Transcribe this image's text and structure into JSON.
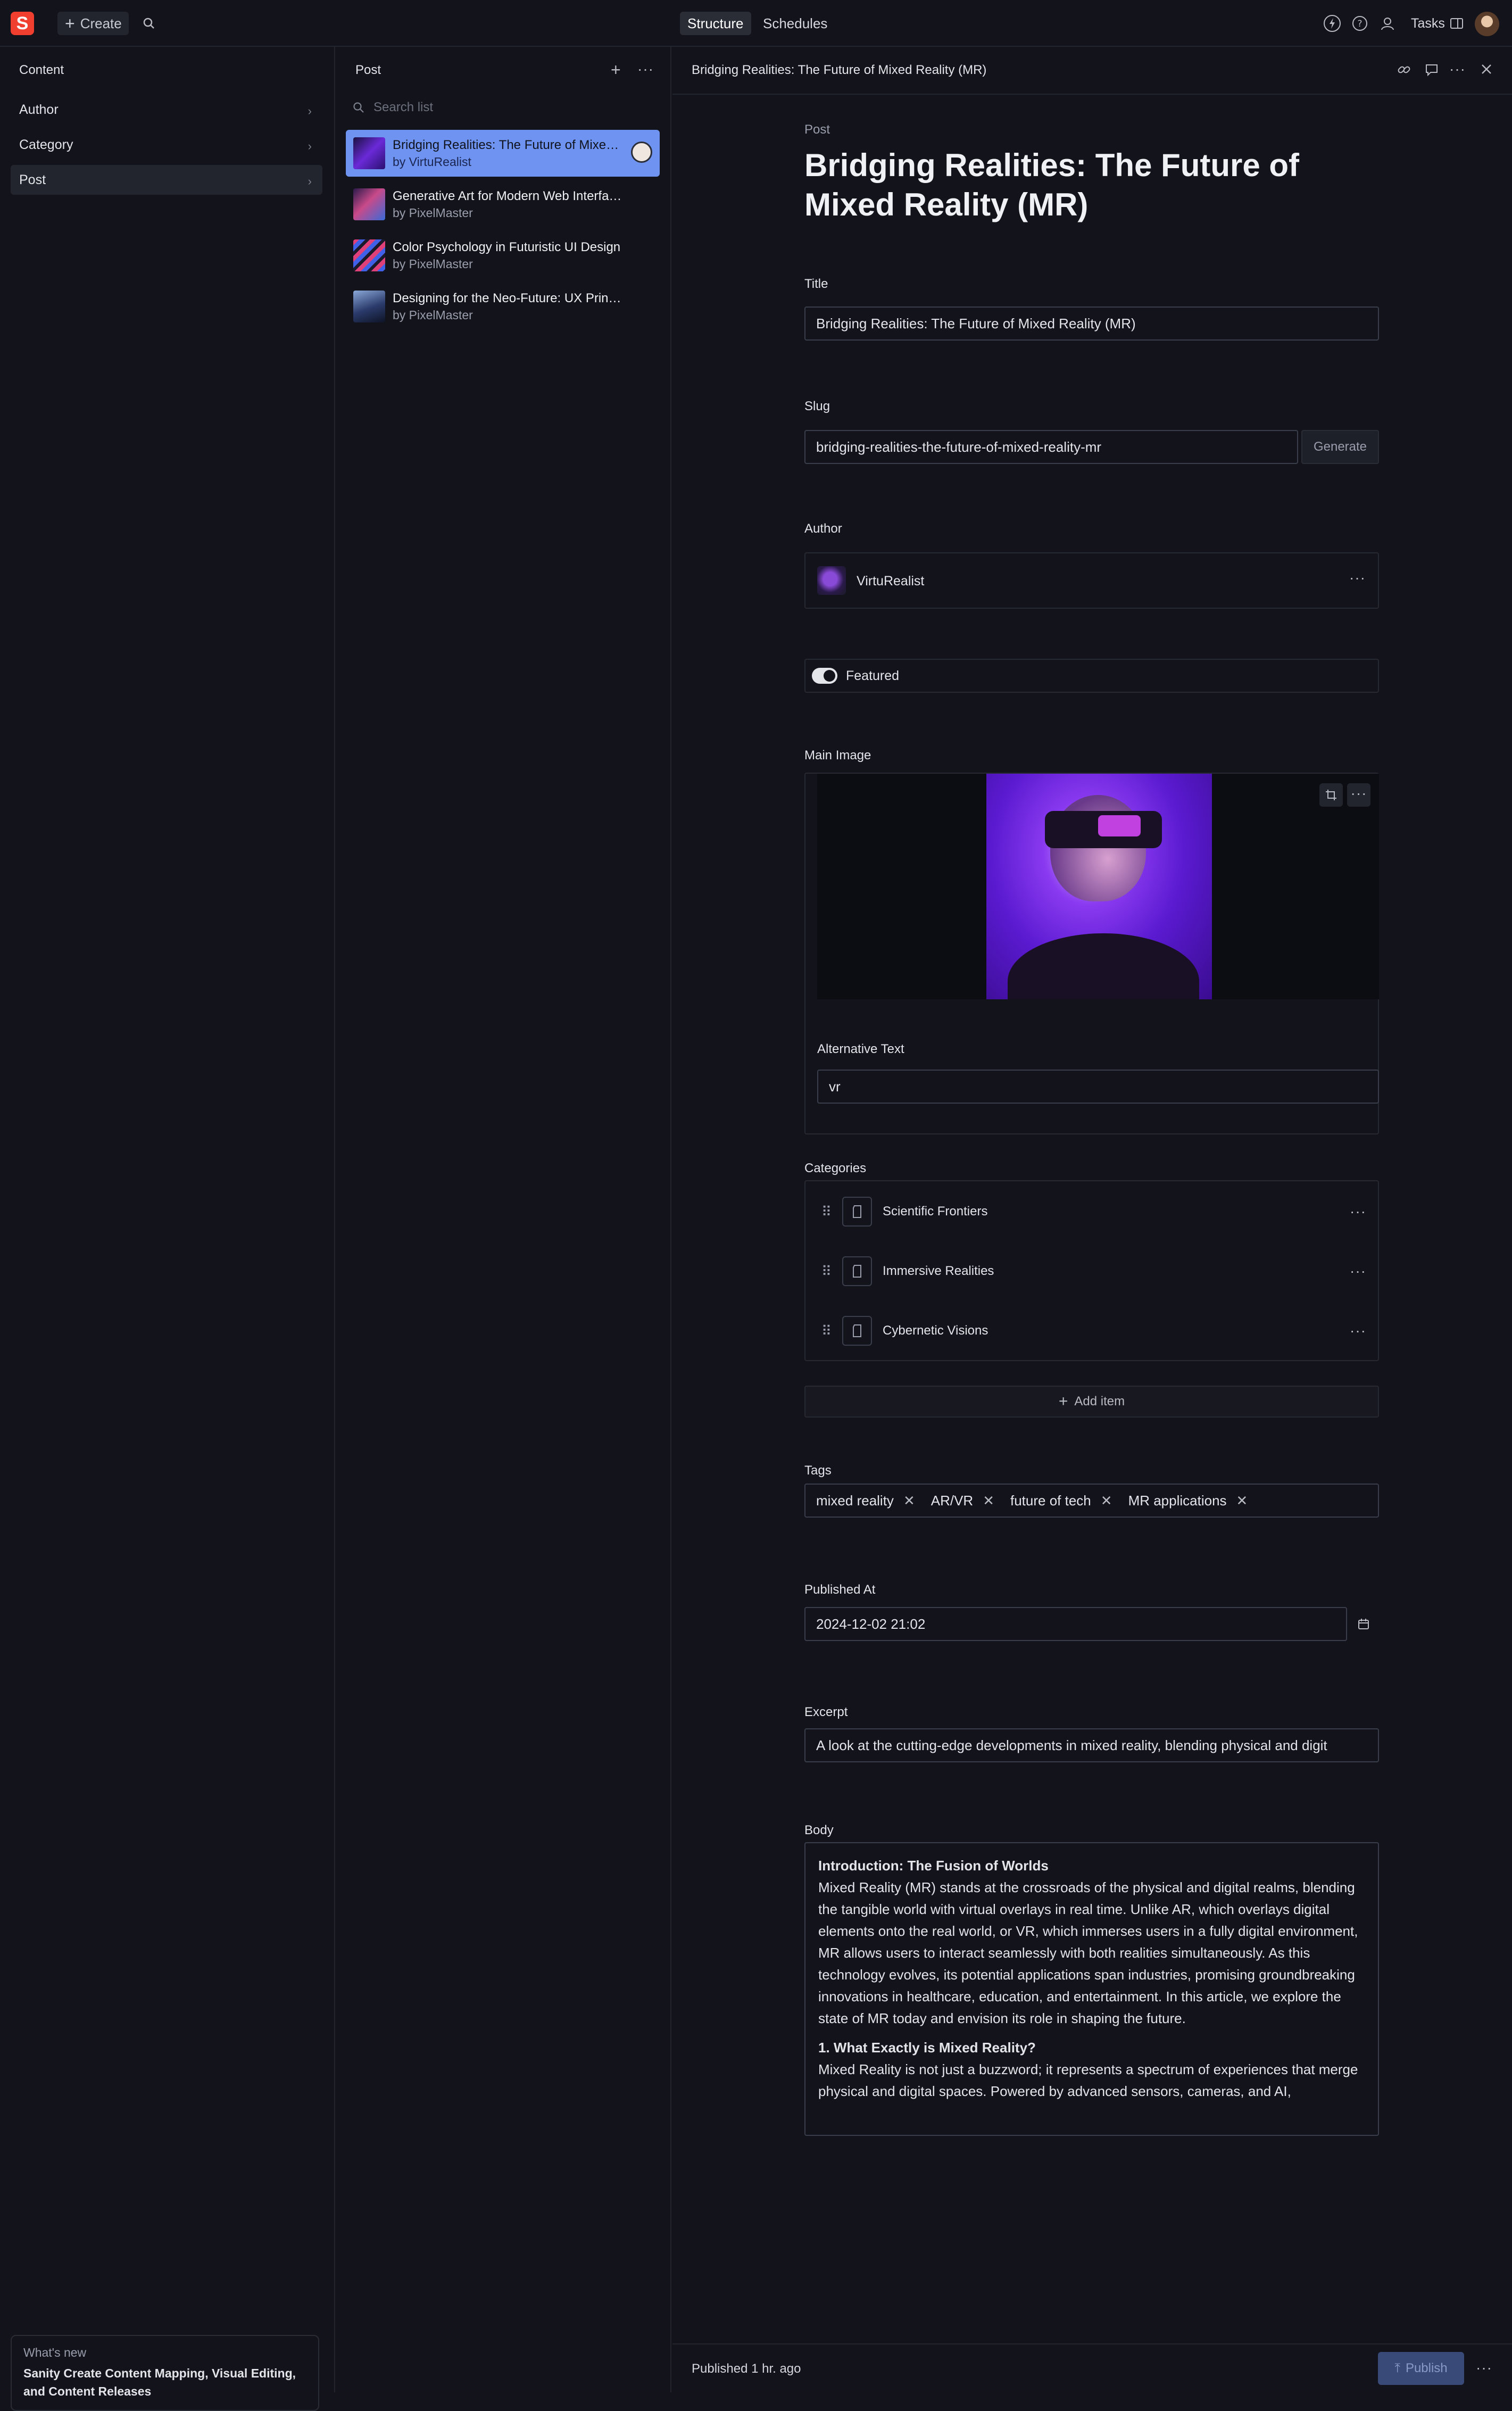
{
  "topbar": {
    "logo_letter": "S",
    "create_label": "Create",
    "tabs": [
      {
        "label": "Structure",
        "active": true
      },
      {
        "label": "Schedules",
        "active": false
      }
    ],
    "tasks_label": "Tasks"
  },
  "content_pane": {
    "title": "Content",
    "items": [
      {
        "label": "Author"
      },
      {
        "label": "Category"
      },
      {
        "label": "Post",
        "selected": true
      }
    ],
    "whats_new": {
      "heading": "What's new",
      "text": "Sanity Create Content Mapping, Visual Editing, and Content Releases"
    }
  },
  "post_pane": {
    "title": "Post",
    "search_placeholder": "Search list",
    "items": [
      {
        "title": "Bridging Realities: The Future of Mixed Reality (MR)",
        "author": "by VirtuRealist",
        "selected": true
      },
      {
        "title": "Generative Art for Modern Web Interfaces",
        "author": "by PixelMaster"
      },
      {
        "title": "Color Psychology in Futuristic UI Design",
        "author": "by PixelMaster"
      },
      {
        "title": "Designing for the Neo-Future: UX Principles",
        "author": "by PixelMaster"
      }
    ]
  },
  "document": {
    "header_title": "Bridging Realities: The Future of Mixed Reality (MR)",
    "type_label": "Post",
    "heading": "Bridging Realities: The Future of Mixed Reality (MR)",
    "fields": {
      "title": {
        "label": "Title",
        "value": "Bridging Realities: The Future of Mixed Reality (MR)"
      },
      "slug": {
        "label": "Slug",
        "value": "bridging-realities-the-future-of-mixed-reality-mr",
        "button": "Generate"
      },
      "author": {
        "label": "Author",
        "value": "VirtuRealist"
      },
      "featured": {
        "label": "Featured",
        "value": true
      },
      "main_image": {
        "label": "Main Image",
        "alt_label": "Alternative Text",
        "alt_value": "vr"
      },
      "categories": {
        "label": "Categories",
        "items": [
          "Scientific Frontiers",
          "Immersive Realities",
          "Cybernetic Visions"
        ],
        "add_label": "Add item"
      },
      "tags": {
        "label": "Tags",
        "items": [
          "mixed reality",
          "AR/VR",
          "future of tech",
          "MR applications"
        ]
      },
      "published_at": {
        "label": "Published At",
        "value": "2024-12-02 21:02"
      },
      "excerpt": {
        "label": "Excerpt",
        "value": "A look at the cutting-edge developments in mixed reality, blending physical and digit"
      },
      "body": {
        "label": "Body",
        "h1": "Introduction: The Fusion of Worlds",
        "p1": "Mixed Reality (MR) stands at the crossroads of the physical and digital realms, blending the tangible world with virtual overlays in real time. Unlike AR, which overlays digital elements onto the real world, or VR, which immerses users in a fully digital environment, MR allows users to interact seamlessly with both realities simultaneously. As this technology evolves, its potential applications span industries, promising groundbreaking innovations in healthcare, education, and entertainment. In this article, we explore the state of MR today and envision its role in shaping the future.",
        "h2": "1. What Exactly is Mixed Reality?",
        "p2": "Mixed Reality is not just a buzzword; it represents a spectrum of experiences that merge physical and digital spaces. Powered by advanced sensors, cameras, and AI,"
      }
    },
    "footer": {
      "status": "Published 1 hr. ago",
      "publish_label": "Publish"
    }
  },
  "colors": {
    "accent": "#6e93f0",
    "brand": "#f03e2f",
    "background": "#13141b"
  }
}
